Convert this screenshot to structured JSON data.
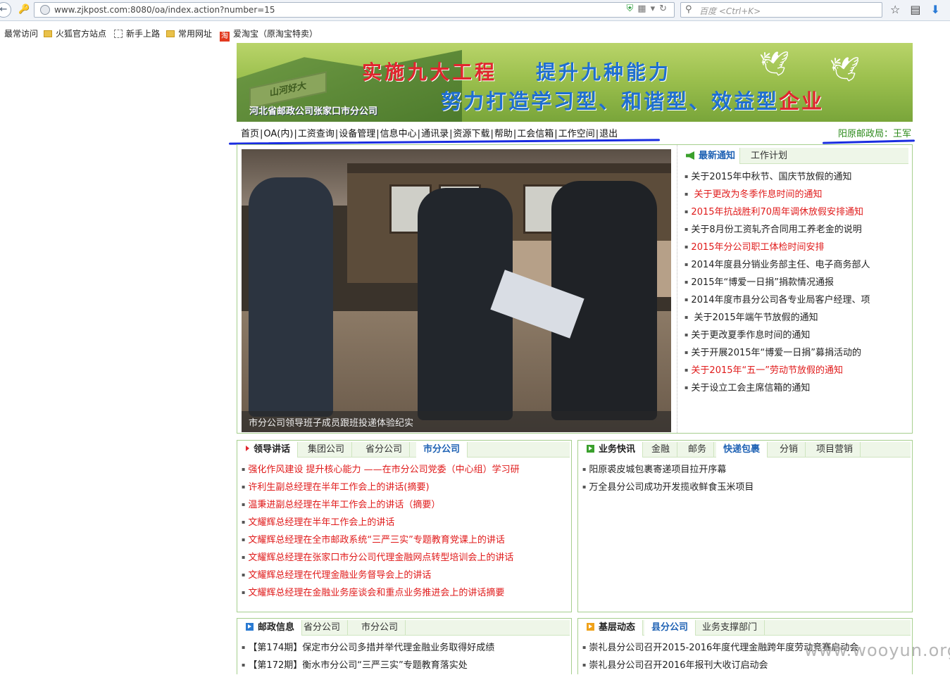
{
  "browser": {
    "url": "www.zjkpost.com:8080/oa/index.action?number=15",
    "search_placeholder": "百度 <Ctrl+K>",
    "bookmarks": [
      "最常访问",
      "火狐官方站点",
      "新手上路",
      "常用网址",
      "爱淘宝（原淘宝特卖）"
    ]
  },
  "banner": {
    "line1_a": "实施九大工程",
    "line1_b": "提升九种能力",
    "line2_a": "努力打造",
    "line2_b": "学习型、和谐型、效益型",
    "line2_c": "企业",
    "wall_text": "山河好大",
    "company": "河北省邮政公司张家口市分公司"
  },
  "menu": {
    "items": [
      "首页",
      "OA(内)",
      "工资查询",
      "设备管理",
      "信息中心",
      "通讯录",
      "资源下载",
      "帮助",
      "工会信箱",
      "工作空间",
      "退出"
    ],
    "user": "阳原邮政局：王军"
  },
  "photo": {
    "caption": "市分公司领导班子成员跟班投递体验纪实"
  },
  "notices": {
    "tabs": [
      "最新通知",
      "工作计划"
    ],
    "items": [
      {
        "text": "关于2015年中秋节、国庆节放假的通知",
        "red": false
      },
      {
        "text": " 关于更改为冬季作息时间的通知",
        "red": true
      },
      {
        "text": "2015年抗战胜利70周年调休放假安排通知",
        "red": true
      },
      {
        "text": "关于8月份工资轧齐合同用工养老金的说明",
        "red": false
      },
      {
        "text": "2015年分公司职工体检时间安排",
        "red": true
      },
      {
        "text": "2014年度县分销业务部主任、电子商务部人",
        "red": false
      },
      {
        "text": "2015年“博爱一日捐”捐款情况通报",
        "red": false
      },
      {
        "text": "2014年度市县分公司各专业局客户经理、项",
        "red": false
      },
      {
        "text": " 关于2015年端午节放假的通知",
        "red": false
      },
      {
        "text": "关于更改夏季作息时间的通知",
        "red": false
      },
      {
        "text": "关于开展2015年“博爱一日捐”募捐活动的",
        "red": false
      },
      {
        "text": "关于2015年“五一”劳动节放假的通知",
        "red": true
      },
      {
        "text": "关于设立工会主席信箱的通知",
        "red": false
      }
    ]
  },
  "leader_box": {
    "tabs": [
      "领导讲话",
      "集团公司",
      "省分公司",
      "市分公司"
    ],
    "items": [
      "强化作风建设  提升核心能力 ——在市分公司党委（中心组）学习研",
      "许利生副总经理在半年工作会上的讲话(摘要)",
      "温秉进副总经理在半年工作会上的讲话（摘要）",
      "文耀辉总经理在半年工作会上的讲话",
      "文耀辉总经理在全市邮政系统“三严三实”专题教育党课上的讲话",
      "文耀辉总经理在张家口市分公司代理金融网点转型培训会上的讲话",
      "文耀辉总经理在代理金融业务督导会上的讲话",
      "文耀辉总经理在金融业务座谈会和重点业务推进会上的讲话摘要"
    ]
  },
  "business_box": {
    "tabs": [
      "业务快讯",
      "金融",
      "邮务",
      "快递包裹",
      "分销",
      "项目营销"
    ],
    "items": [
      "阳原裘皮城包裹寄递项目拉开序幕",
      "万全县分公司成功开发揽收鲜食玉米项目"
    ]
  },
  "postal_box": {
    "tabs": [
      "邮政信息",
      "省分公司",
      "市分公司"
    ],
    "items": [
      "【第174期】保定市分公司多措并举代理金融业务取得好成绩",
      "【第172期】衡水市分公司“三严三实”专题教育落实处"
    ]
  },
  "grassroots_box": {
    "tabs": [
      "基层动态",
      "县分公司",
      "业务支撑部门"
    ],
    "items": [
      "崇礼县分公司召开2015-2016年度代理金融跨年度劳动竞赛启动会",
      "崇礼县分公司召开2016年报刊大收订启动会"
    ]
  },
  "watermark": "www.wooyun.org"
}
